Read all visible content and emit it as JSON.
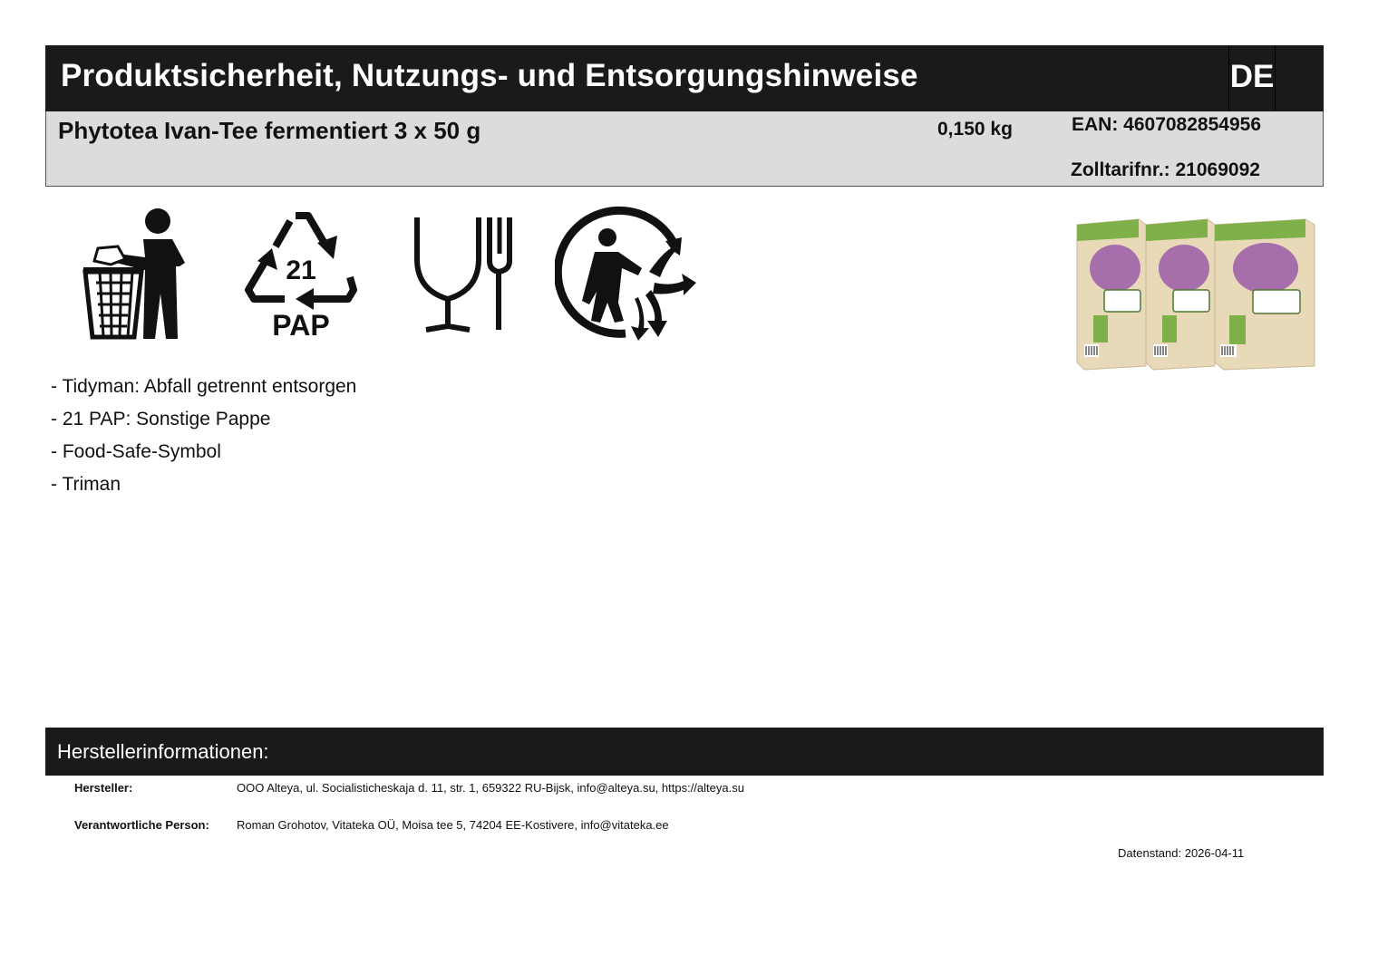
{
  "header": {
    "title": "Produktsicherheit, Nutzungs- und Entsorgungshinweise",
    "language": "DE"
  },
  "product": {
    "name": "Phytotea Ivan-Tee fermentiert 3 x 50 g",
    "weight": "0,150 kg",
    "ean": "EAN: 4607082854956",
    "tariff": "Zolltarifnr.: 21069092"
  },
  "symbols": {
    "recycling_code": "21",
    "recycling_material": "PAP",
    "icons": [
      "tidyman-icon",
      "recycling-21-pap-icon",
      "food-safe-icon",
      "triman-icon"
    ]
  },
  "legend": [
    "- Tidyman: Abfall getrennt entsorgen",
    "- 21 PAP: Sonstige Pappe",
    "- Food-Safe-Symbol",
    "- Triman"
  ],
  "manufacturer": {
    "section_title": "Herstellerinformationen:",
    "manufacturer_label": "Hersteller:",
    "manufacturer_value": "OOO Alteya, ul. Socialisticheskaja d. 11, str. 1, 659322 RU-Bijsk, info@alteya.su, https://alteya.su",
    "responsible_label": "Verantwortliche Person:",
    "responsible_value": "Roman Grohotov, Vitateka OÜ, Moisa tee 5, 74204 EE-Kostivere, info@vitateka.ee"
  },
  "date_stand": "Datenstand: 2026-04-11",
  "colors": {
    "dark_bar": "#1a1a1a",
    "info_bg": "#dcdcdc",
    "package_beige": "#e8d9b8",
    "package_green": "#7fb04a",
    "flower_purple": "#9a5aa8"
  }
}
